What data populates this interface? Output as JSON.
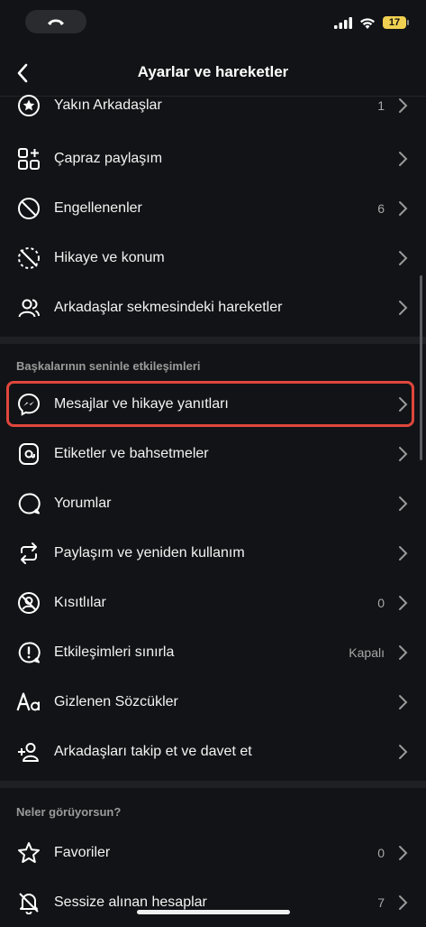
{
  "header": {
    "title": "Ayarlar ve hareketler"
  },
  "status": {
    "battery": "17"
  },
  "top_rows": [
    {
      "label": "Yakın Arkadaşlar",
      "value": "1",
      "icon": "star-circle-icon"
    },
    {
      "label": "Çapraz paylaşım",
      "value": "",
      "icon": "grid-plus-icon"
    },
    {
      "label": "Engellenenler",
      "value": "6",
      "icon": "block-icon"
    },
    {
      "label": "Hikaye ve konum",
      "value": "",
      "icon": "story-off-icon"
    },
    {
      "label": "Arkadaşlar sekmesindeki hareketler",
      "value": "",
      "icon": "people-icon"
    }
  ],
  "section_interactions": {
    "title": "Başkalarının seninle etkileşimleri",
    "rows": [
      {
        "label": "Mesajlar ve hikaye yanıtları",
        "value": "",
        "icon": "messenger-icon"
      },
      {
        "label": "Etiketler ve bahsetmeler",
        "value": "",
        "icon": "at-sign-icon"
      },
      {
        "label": "Yorumlar",
        "value": "",
        "icon": "comment-icon"
      },
      {
        "label": "Paylaşım ve yeniden kullanım",
        "value": "",
        "icon": "repost-icon"
      },
      {
        "label": "Kısıtlılar",
        "value": "0",
        "icon": "restrict-icon"
      },
      {
        "label": "Etkileşimleri sınırla",
        "value": "Kapalı",
        "icon": "alert-circle-icon"
      },
      {
        "label": "Gizlenen Sözcükler",
        "value": "",
        "icon": "text-aa-icon"
      },
      {
        "label": "Arkadaşları takip et ve davet et",
        "value": "",
        "icon": "add-person-icon"
      }
    ]
  },
  "section_seen": {
    "title": "Neler görüyorsun?",
    "rows": [
      {
        "label": "Favoriler",
        "value": "0",
        "icon": "star-outline-icon"
      },
      {
        "label": "Sessize alınan hesaplar",
        "value": "7",
        "icon": "bell-off-icon"
      }
    ]
  },
  "colors": {
    "background": "#121316",
    "highlight": "#e0463c",
    "text": "#f3f3f3",
    "muted": "#a8a8a8"
  }
}
